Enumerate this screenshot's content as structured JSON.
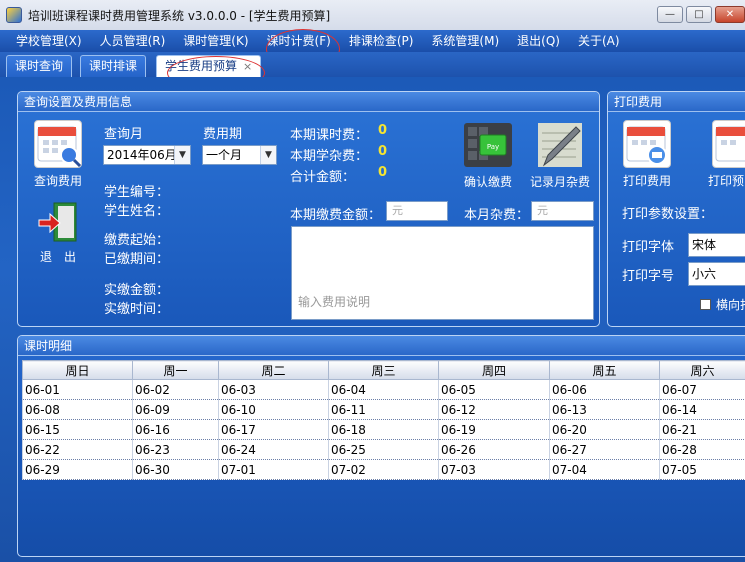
{
  "app": {
    "title": "培训班课程课时费用管理系统  v3.0.0.0 - [学生费用预算]",
    "window_controls": {
      "minimize": "—",
      "maximize": "□",
      "close": "✕"
    }
  },
  "menu": [
    "学校管理(X)",
    "人员管理(R)",
    "课时管理(K)",
    "课时计费(F)",
    "排课检查(P)",
    "系统管理(M)",
    "退出(Q)",
    "关于(A)"
  ],
  "tabs": [
    {
      "label": "课时查询"
    },
    {
      "label": "课时排课"
    },
    {
      "label": "学生费用预算",
      "close": "×"
    }
  ],
  "query_panel": {
    "title": "查询设置及费用信息",
    "query_button": "查询费用",
    "exit_button": "退　出",
    "query_month_label": "查询月",
    "query_month_value": "2014年06月",
    "fee_period_label": "费用期",
    "fee_period_value": "一个月",
    "student_no_label": "学生编号：",
    "student_name_label": "学生姓名：",
    "pay_start_label": "缴费起始：",
    "paid_period_label": "已缴期间：",
    "paid_amount_label": "实缴金额：",
    "paid_time_label": "实缴时间：",
    "period_class_fee_label": "本期课时费：",
    "period_class_fee_value": "0",
    "period_misc_fee_label": "本期学杂费：",
    "period_misc_fee_value": "0",
    "total_label": "合计金额：",
    "total_value": "0",
    "confirm_pay_button": "确认缴费",
    "record_misc_button": "记录月杂费",
    "period_pay_amount_label": "本期缴费金额：",
    "period_pay_amount_placeholder": "元",
    "month_misc_label": "本月杂费：",
    "month_misc_placeholder": "元",
    "fee_note_placeholder": "输入费用说明"
  },
  "print_panel": {
    "title": "打印费用",
    "print_fee_button": "打印费用",
    "print_preview_button": "打印预",
    "print_settings_label": "打印参数设置：",
    "print_font_label": "打印字体",
    "print_font_value": "宋体",
    "print_size_label": "打印字号",
    "print_size_value": "小六",
    "landscape_label": "横向打"
  },
  "detail_panel": {
    "title": "课时明细",
    "columns": [
      "周日",
      "周一",
      "周二",
      "周三",
      "周四",
      "周五",
      "周六"
    ],
    "rows": [
      [
        "06-01",
        "06-02",
        "06-03",
        "06-04",
        "06-05",
        "06-06",
        "06-07"
      ],
      [
        "06-08",
        "06-09",
        "06-10",
        "06-11",
        "06-12",
        "06-13",
        "06-14"
      ],
      [
        "06-15",
        "06-16",
        "06-17",
        "06-18",
        "06-19",
        "06-20",
        "06-21"
      ],
      [
        "06-22",
        "06-23",
        "06-24",
        "06-25",
        "06-26",
        "06-27",
        "06-28"
      ],
      [
        "06-29",
        "06-30",
        "07-01",
        "07-02",
        "07-03",
        "07-04",
        "07-05"
      ]
    ]
  },
  "colors": {
    "accent_blue": "#1a58ba",
    "value_yellow": "#f5e531",
    "annotation_red": "#dd3333"
  }
}
